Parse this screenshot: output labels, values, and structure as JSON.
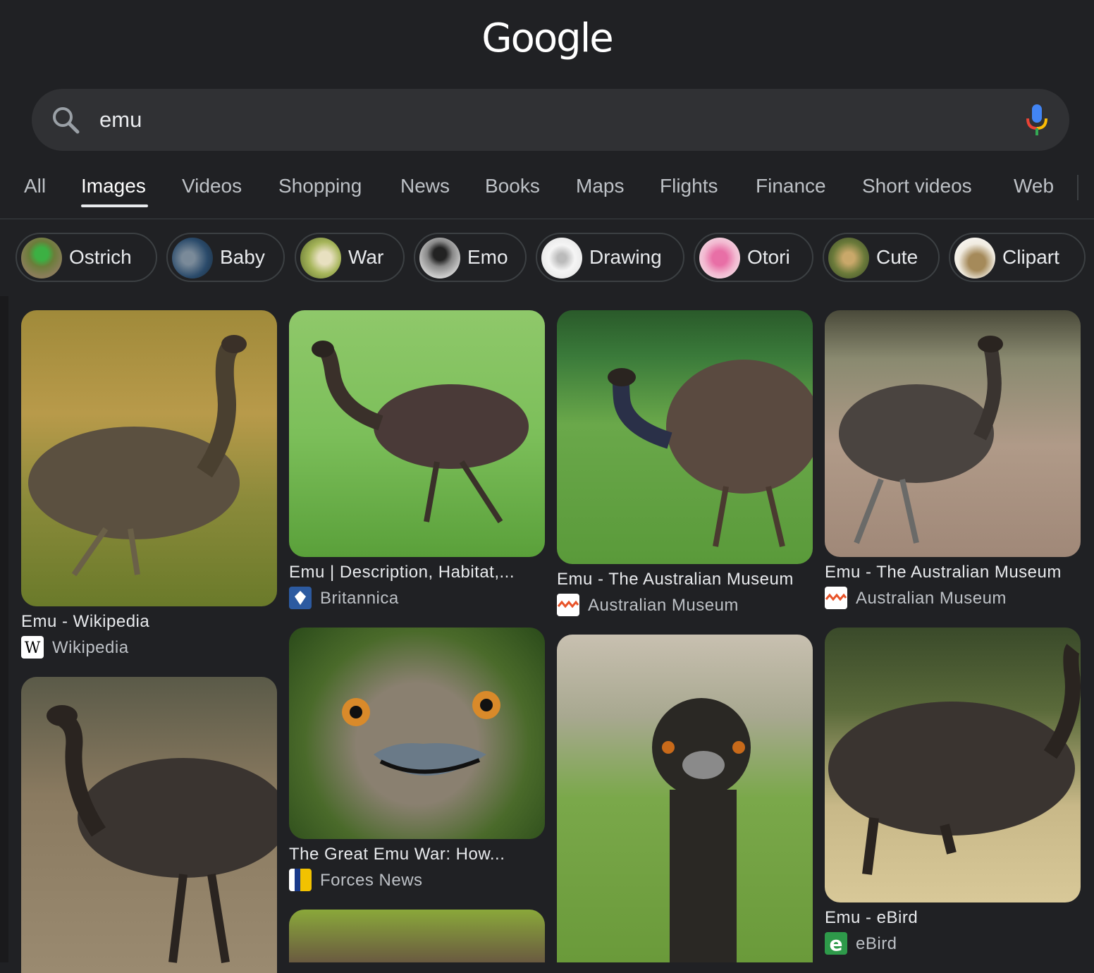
{
  "logo": "Google",
  "search": {
    "query": "emu"
  },
  "tabs": [
    {
      "label": "All"
    },
    {
      "label": "Images",
      "active": true
    },
    {
      "label": "Videos"
    },
    {
      "label": "Shopping"
    },
    {
      "label": "News"
    },
    {
      "label": "Books"
    },
    {
      "label": "Maps"
    },
    {
      "label": "Flights"
    },
    {
      "label": "Finance"
    },
    {
      "label": "Short videos"
    },
    {
      "label": "Web"
    }
  ],
  "chips": [
    {
      "label": "Ostrich"
    },
    {
      "label": "Baby"
    },
    {
      "label": "War"
    },
    {
      "label": "Emo"
    },
    {
      "label": "Drawing"
    },
    {
      "label": "Otori"
    },
    {
      "label": "Cute"
    },
    {
      "label": "Clipart"
    }
  ],
  "results": [
    {
      "title": "Emu - Wikipedia",
      "source": "Wikipedia",
      "source_icon": "wikipedia-icon"
    },
    {
      "title": "Emu | Description, Habitat,...",
      "source": "Britannica",
      "source_icon": "britannica-icon"
    },
    {
      "title": "Emu - The Australian Museum",
      "source": "Australian Museum",
      "source_icon": "australian-museum-icon"
    },
    {
      "title": "Emu - The Australian Museum",
      "source": "Australian Museum",
      "source_icon": "australian-museum-icon"
    },
    {
      "title": "The Great Emu War: How...",
      "source": "Forces News",
      "source_icon": "forces-news-icon"
    },
    {
      "title": "Emu - eBird",
      "source": "eBird",
      "source_icon": "ebird-icon"
    }
  ],
  "colors": {
    "background": "#202124",
    "searchbar": "#303134",
    "text": "#e8eaed",
    "muted": "#bdc1c6",
    "border": "#3c4043"
  }
}
